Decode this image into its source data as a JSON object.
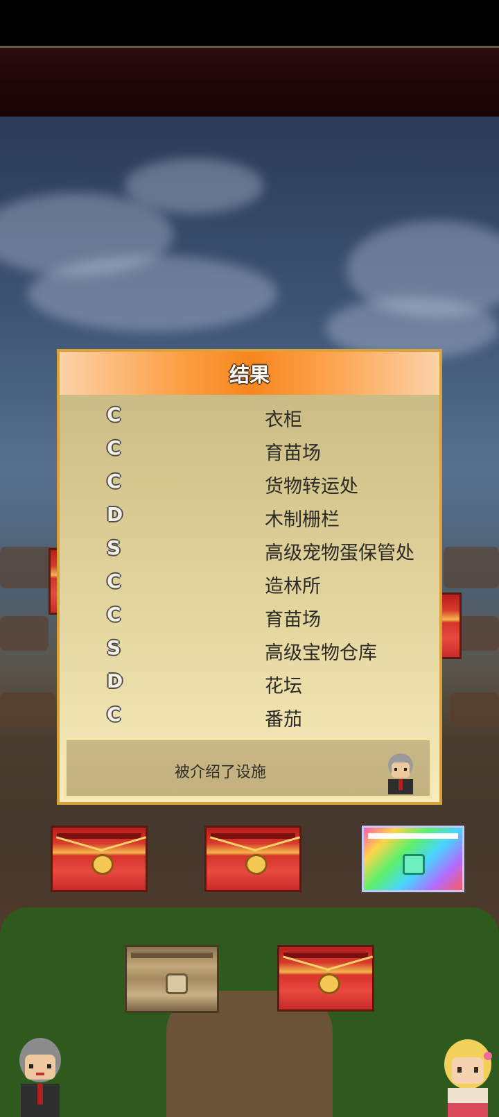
{
  "dialog": {
    "title": "结果",
    "results": [
      {
        "grade": "C",
        "facility": "衣柜"
      },
      {
        "grade": "C",
        "facility": "育苗场"
      },
      {
        "grade": "C",
        "facility": "货物转运处"
      },
      {
        "grade": "D",
        "facility": "木制栅栏"
      },
      {
        "grade": "S",
        "facility": "高级宠物蛋保管处"
      },
      {
        "grade": "C",
        "facility": "造林所"
      },
      {
        "grade": "C",
        "facility": "育苗场"
      },
      {
        "grade": "S",
        "facility": "高级宝物仓库"
      },
      {
        "grade": "D",
        "facility": "花坛"
      },
      {
        "grade": "C",
        "facility": "番茄"
      }
    ],
    "footer_message": "被介绍了设施"
  },
  "chests": [
    {
      "type": "red",
      "icon": "red-chest-icon"
    },
    {
      "type": "red",
      "icon": "red-chest-icon"
    },
    {
      "type": "rainbow",
      "icon": "rainbow-chest-icon"
    },
    {
      "type": "wood",
      "icon": "wooden-chest-icon"
    },
    {
      "type": "red",
      "icon": "red-chest-icon"
    }
  ],
  "colors": {
    "header_orange": "#f7861d",
    "dialog_border": "#d9a23a",
    "banner_dark_red": "#1c0506"
  }
}
